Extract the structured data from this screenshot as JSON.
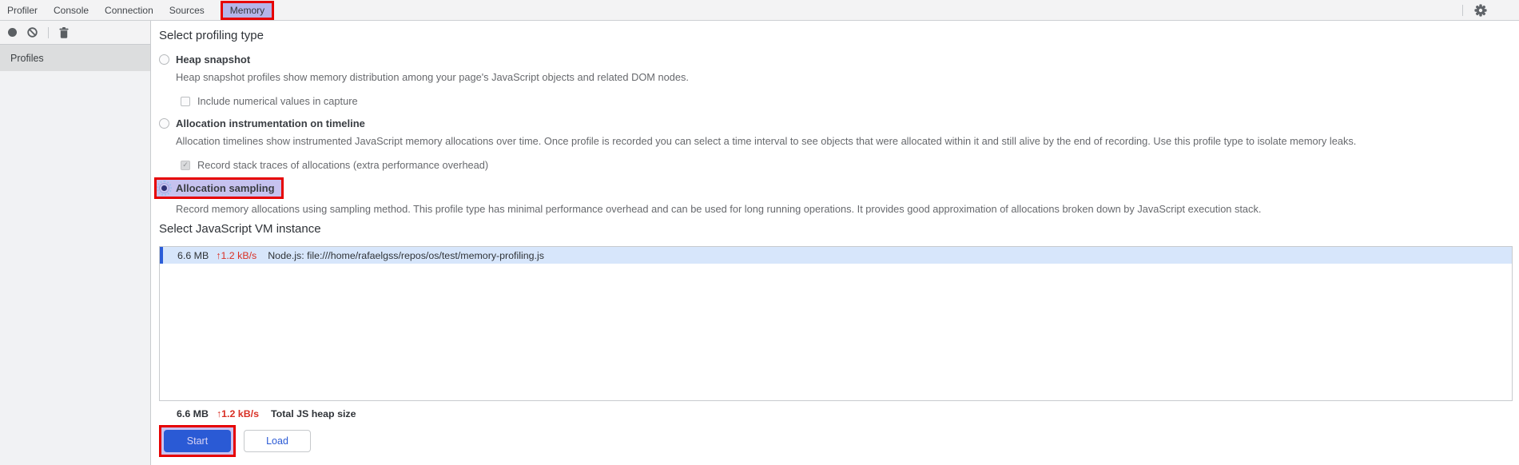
{
  "tabs": {
    "items": [
      {
        "label": "Profiler"
      },
      {
        "label": "Console"
      },
      {
        "label": "Connection"
      },
      {
        "label": "Sources"
      },
      {
        "label": "Memory"
      }
    ],
    "active": "Memory"
  },
  "icons": {
    "check_glyph": "✓"
  },
  "sidebar": {
    "profiles_label": "Profiles"
  },
  "profiling": {
    "heading": "Select profiling type",
    "options": [
      {
        "label": "Heap snapshot",
        "selected": false,
        "desc": "Heap snapshot profiles show memory distribution among your page's JavaScript objects and related DOM nodes.",
        "checkbox": {
          "label": "Include numerical values in capture",
          "checked": false
        }
      },
      {
        "label": "Allocation instrumentation on timeline",
        "selected": false,
        "desc": "Allocation timelines show instrumented JavaScript memory allocations over time. Once profile is recorded you can select a time interval to see objects that were allocated within it and still alive by the end of recording. Use this profile type to isolate memory leaks.",
        "checkbox": {
          "label": "Record stack traces of allocations (extra performance overhead)",
          "checked": true,
          "disabled": true
        }
      },
      {
        "label": "Allocation sampling",
        "selected": true,
        "highlighted": true,
        "desc": "Record memory allocations using sampling method. This profile type has minimal performance overhead and can be used for long running operations. It provides good approximation of allocations broken down by JavaScript execution stack."
      }
    ]
  },
  "vm": {
    "heading": "Select JavaScript VM instance",
    "instances": [
      {
        "size": "6.6 MB",
        "rate": "↑1.2 kB/s",
        "name": "Node.js: file:///home/rafaelgss/repos/os/test/memory-profiling.js",
        "selected": true
      }
    ],
    "total": {
      "size": "6.6 MB",
      "rate": "↑1.2 kB/s",
      "label": "Total JS heap size"
    }
  },
  "actions": {
    "start_label": "Start",
    "load_label": "Load"
  },
  "colors": {
    "annotation_red": "#e60000",
    "annotation_lavender": "#c6c2ef",
    "selected_row_blue": "#d7e6fb",
    "row_accent_blue": "#2c5dd8",
    "start_button_blue": "#2a5ad5",
    "rate_red": "#d93025"
  }
}
